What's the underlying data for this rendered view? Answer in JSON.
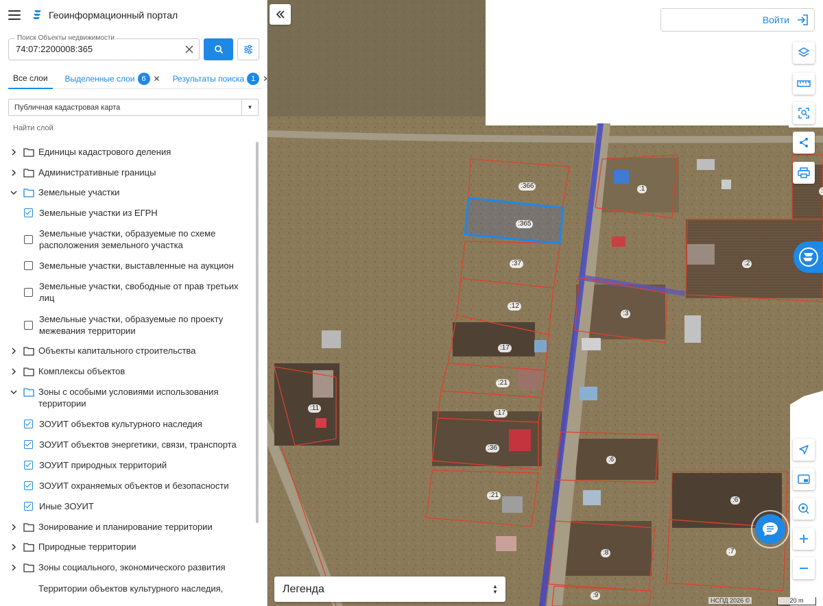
{
  "app": {
    "title": "Геоинформационный портал"
  },
  "search": {
    "legend": "Поиск Объекты недвижимости",
    "value": "74:07:2200008:365"
  },
  "tabs": {
    "all": "Все слои",
    "selected": {
      "label": "Выделенные слои",
      "count": "6"
    },
    "results": {
      "label": "Результаты поиска",
      "count": "1"
    }
  },
  "basemap": {
    "value": "Публичная кадастровая карта"
  },
  "find_layer": "Найти слой",
  "layers": {
    "cadastral_units": "Единицы кадастрового деления",
    "admin_borders": "Административные границы",
    "land_plots": "Земельные участки",
    "land_plots_egrn": "Земельные участки из ЕГРН",
    "land_plots_scheme": "Земельные участки, образуемые по схеме расположения земельного участка",
    "land_plots_auction": "Земельные участки, выставленные на аукцион",
    "land_plots_free": "Земельные участки, свободные от прав третьих лиц",
    "land_plots_project": "Земельные участки, образуемые по проекту межевания территории",
    "capital_objects": "Объекты капитального строительства",
    "object_complexes": "Комплексы объектов",
    "special_zones": "Зоны с особыми условиями использования территории",
    "zouit_culture": "ЗОУИТ объектов культурного наследия",
    "zouit_energy": "ЗОУИТ объектов энергетики, связи, транспорта",
    "zouit_nature": "ЗОУИТ природных территорий",
    "zouit_protected": "ЗОУИТ охраняемых объектов и безопасности",
    "zouit_other": "Иные ЗОУИТ",
    "zoning": "Зонирование и планирование территории",
    "natural_areas": "Природные территории",
    "social_zones": "Зоны социального, экономического развития",
    "culture_territories": "Территории объектов культурного наследия,"
  },
  "map": {
    "login_label": "Войти",
    "legend_title": "Легенда",
    "copyright": "НСПД 2026 ©",
    "scale": "20 m",
    "parcel_labels": {
      "p366": ":366",
      "p365": ":365",
      "p37": ":37",
      "p12": ":12",
      "p17a": ":17",
      "p21a": ":21",
      "p17b": ":17",
      "p36": ":36",
      "p21b": ":21",
      "p11": ":11",
      "p1": ":1",
      "p2": ":2",
      "p3": ":3",
      "p6a": ":6",
      "p6b": ":6",
      "p7": ":7",
      "p8": ":8",
      "p9": ":9",
      "p3edge": ":3"
    }
  },
  "colors": {
    "accent": "#1e88e5",
    "parcel_border": "#e0402a",
    "selected_parcel": "#1e88e5",
    "road_overlay": "#3b3fc9"
  }
}
